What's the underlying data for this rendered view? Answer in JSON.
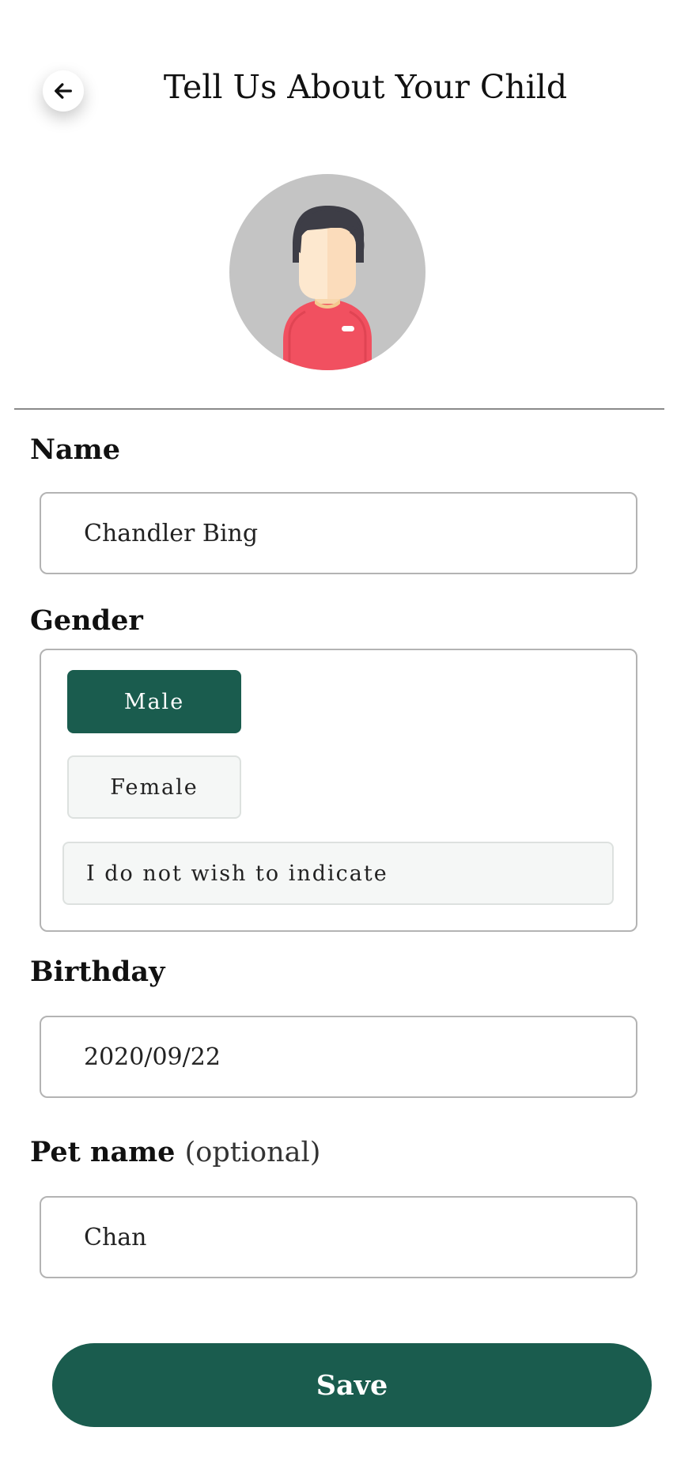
{
  "header": {
    "back_icon": "arrow-left-icon",
    "title": "Tell Us About Your Child"
  },
  "avatar": {
    "icon": "boy-avatar-icon",
    "background": "#c4c4c4"
  },
  "form": {
    "name": {
      "label": "Name",
      "value": "Chandler Bing"
    },
    "gender": {
      "label": "Gender",
      "options": [
        "Male",
        "Female",
        "I do not wish to indicate"
      ],
      "selected": "Male"
    },
    "birthday": {
      "label": "Birthday",
      "value": "2020/09/22"
    },
    "pet_name": {
      "label": "Pet name",
      "optional": "(optional)",
      "value": "Chan"
    }
  },
  "actions": {
    "save_label": "Save"
  },
  "colors": {
    "accent": "#1a5c4e",
    "chip_inactive": "#f5f7f6"
  }
}
